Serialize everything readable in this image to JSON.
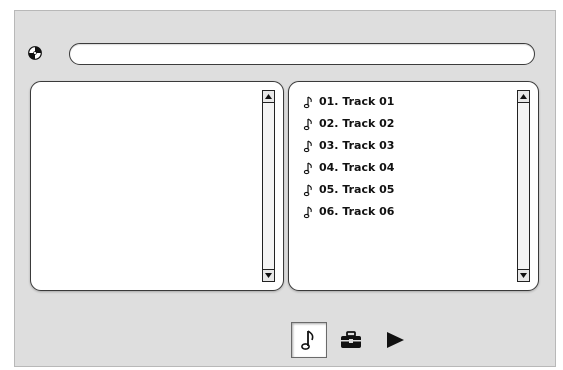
{
  "address_bar": {
    "value": ""
  },
  "tracks": [
    "01. Track 01",
    "02. Track 02",
    "03. Track 03",
    "04. Track 04",
    "05. Track 05",
    "06. Track 06"
  ],
  "icons": {
    "disc": "cd-disc-icon",
    "note": "music-note-icon",
    "music_tab": "music-note-icon",
    "briefcase_tab": "briefcase-icon",
    "play_tab": "play-icon",
    "scroll_up": "scroll-up-arrow-icon",
    "scroll_down": "scroll-down-arrow-icon"
  },
  "colors": {
    "window_background": "#dedede",
    "pane_background": "#ffffff",
    "border": "#3a3a3a"
  }
}
